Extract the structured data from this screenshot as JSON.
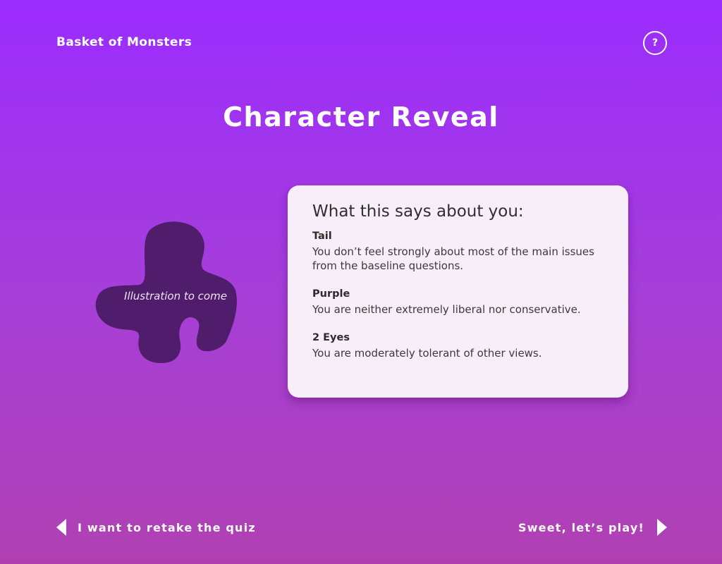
{
  "header": {
    "app_title": "Basket of Monsters",
    "help_label": "?"
  },
  "page_title": "Character Reveal",
  "illustration": {
    "placeholder_text": "Illustration to come",
    "color": "#4f1d6b"
  },
  "results": {
    "heading": "What this says about you:",
    "traits": [
      {
        "name": "Tail",
        "description": "You don’t feel strongly about most of the main issues from the baseline questions."
      },
      {
        "name": "Purple",
        "description": "You are neither extremely liberal nor conservative."
      },
      {
        "name": "2 Eyes",
        "description": "You are moderately tolerant of other views."
      }
    ]
  },
  "navigation": {
    "back_label": "I want to retake the quiz",
    "next_label": "Sweet, let’s play!",
    "back_icon": "arrow-left-icon",
    "next_icon": "arrow-right-icon"
  },
  "colors": {
    "background_top": "#9b2cff",
    "background_bottom": "#b040b2",
    "card_background": "#f8eef9",
    "text_light": "#ffffff"
  }
}
